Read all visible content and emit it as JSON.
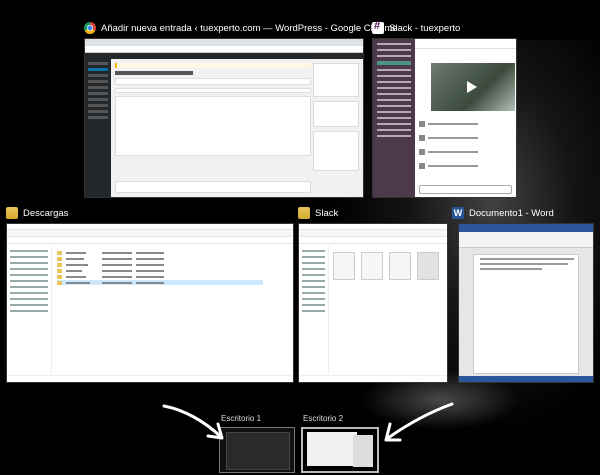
{
  "windows": {
    "chrome": {
      "title": "Añadir nueva entrada ‹ tuexperto.com — WordPress - Google Chrome",
      "icon": "chrome-icon"
    },
    "slack_top": {
      "title": "Slack - tuexperto",
      "icon": "slack-icon"
    },
    "descargas": {
      "title": "Descargas",
      "icon": "folder-icon"
    },
    "slack_folder": {
      "title": "Slack",
      "icon": "folder-icon"
    },
    "word": {
      "title": "Documento1 - Word",
      "icon": "word-icon"
    }
  },
  "desktops": [
    {
      "label": "Escritorio 1"
    },
    {
      "label": "Escritorio 2"
    }
  ],
  "colors": {
    "background": "#000000",
    "slack_sidebar": "#4d394b",
    "word_brand": "#2b579a",
    "wp_adminbar": "#23282d"
  }
}
